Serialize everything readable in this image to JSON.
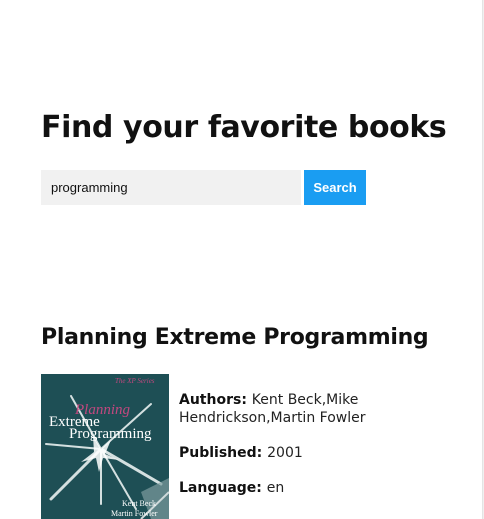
{
  "header": {
    "title": "Find your favorite books"
  },
  "search": {
    "value": "programming",
    "button_label": "Search"
  },
  "book": {
    "title": "Planning Extreme Programming",
    "cover": {
      "series": "The XP Series",
      "title_line1": "Planning",
      "title_line2": "Extreme",
      "title_line3": "Programming",
      "author1": "Kent Beck",
      "author2": "Martin Fowler",
      "bg_color": "#1c4a4f",
      "accent_color": "#c2487f"
    },
    "authors_label": "Authors:",
    "authors": "Kent Beck,Mike Hendrickson,Martin Fowler",
    "published_label": "Published:",
    "published": "2001",
    "language_label": "Language:",
    "language": "en"
  },
  "colors": {
    "accent": "#1a9df2",
    "input_bg": "#f1f1f1"
  }
}
